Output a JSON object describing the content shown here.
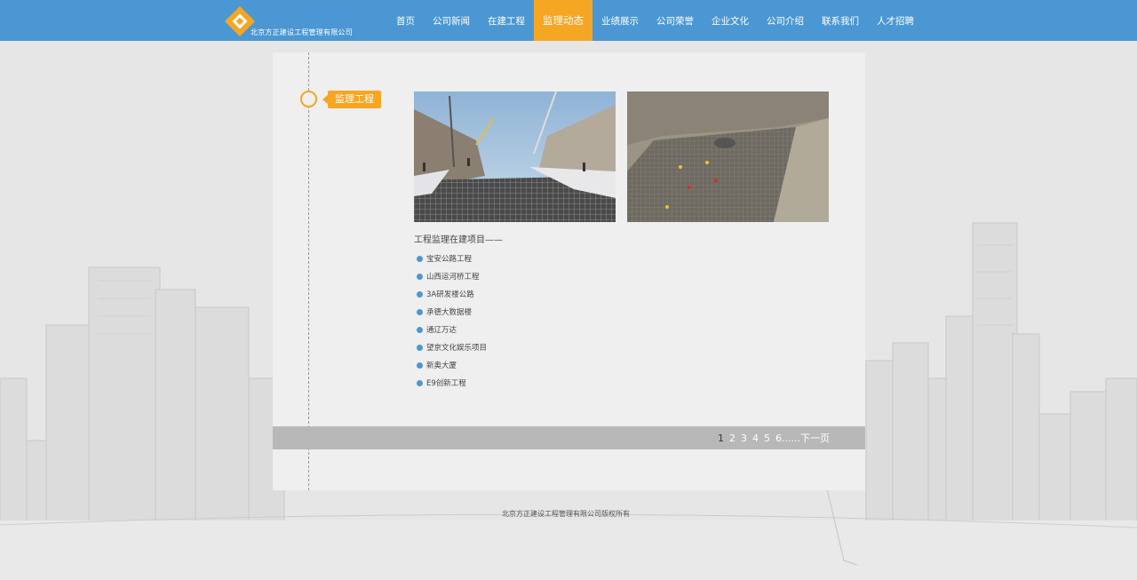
{
  "header": {
    "company_name": "北京方正建设工程管理有限公司",
    "nav": [
      {
        "label": "首页",
        "active": false
      },
      {
        "label": "公司新闻",
        "active": false
      },
      {
        "label": "在建工程",
        "active": false
      },
      {
        "label": "监理动态",
        "active": true
      },
      {
        "label": "业绩展示",
        "active": false
      },
      {
        "label": "公司荣誉",
        "active": false
      },
      {
        "label": "企业文化",
        "active": false
      },
      {
        "label": "公司介绍",
        "active": false
      },
      {
        "label": "联系我们",
        "active": false
      },
      {
        "label": "人才招聘",
        "active": false
      }
    ]
  },
  "main": {
    "section_tag": "监理工程",
    "project_heading": "工程监理在建项目——",
    "projects": [
      "宝安公路工程",
      "山西运河桥工程",
      "3A研发楼公路",
      "承德大数据楼",
      "通辽万达",
      "望京文化娱乐项目",
      "新奥大厦",
      "E9创新工程"
    ]
  },
  "pagination": {
    "pages": [
      "1",
      "2",
      "3",
      "4",
      "5",
      "6"
    ],
    "current": "1",
    "ellipsis_next": "......下一页"
  },
  "footer": {
    "copyright": "北京方正建设工程管理有限公司版权所有"
  },
  "colors": {
    "header_bg": "#4b97d3",
    "accent": "#f5a623",
    "panel_bg": "#efefef",
    "pager_bg": "#b8b8b8"
  }
}
